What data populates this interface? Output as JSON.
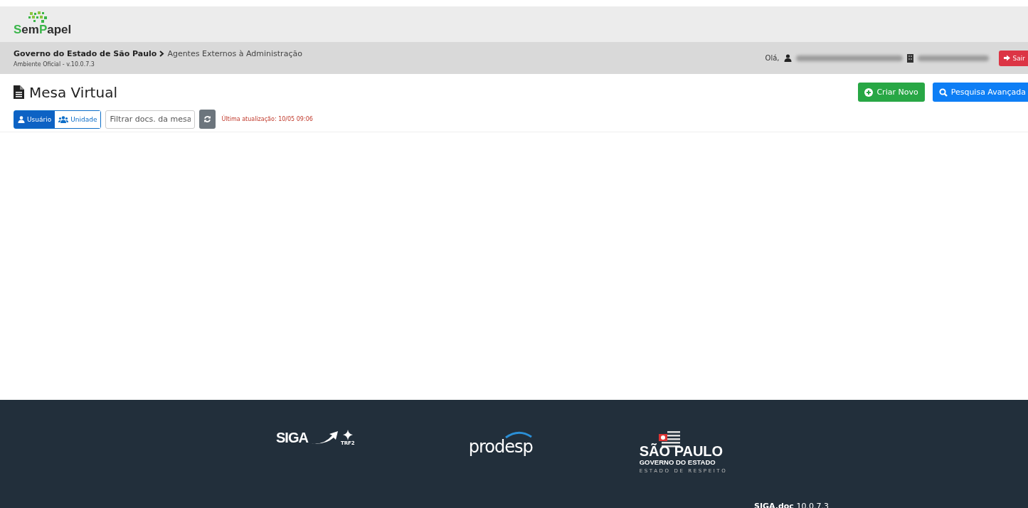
{
  "brand": {
    "parts": [
      {
        "text": "S",
        "accent": true
      },
      {
        "text": "em",
        "accent": false
      },
      {
        "text": "P",
        "accent": true
      },
      {
        "text": "apel",
        "accent": false
      }
    ]
  },
  "header": {
    "org": "Governo do Estado de São Paulo",
    "unit": "Agentes Externos à Administração",
    "environment": "Ambiente Oficial - v.10.0.7.3",
    "greeting": "Olá,",
    "logout": "Sair"
  },
  "page": {
    "title": "Mesa Virtual",
    "buttons": [
      {
        "label": "Criar Novo",
        "kind": "create"
      },
      {
        "label": "Pesquisa Avançada",
        "kind": "search"
      }
    ]
  },
  "toolbar": {
    "scopes": [
      {
        "label": "Usuário",
        "kind": "user",
        "selected": true
      },
      {
        "label": "Unidade",
        "kind": "group",
        "selected": false
      }
    ],
    "filter": {
      "placeholder": "Filtrar docs. da mesa"
    },
    "last_update": "Última atualização: 10/05 09:06"
  },
  "footer": {
    "siga": {
      "name": "SIGA",
      "sub": "TRF2"
    },
    "prodesp": "prodesp",
    "sp": {
      "name": "SÃO PAULO",
      "line": "GOVERNO DO ESTADO",
      "motto": "ESTADO DE RESPEITO"
    },
    "version": "**SIGA.doc** 10.0.7.3"
  }
}
